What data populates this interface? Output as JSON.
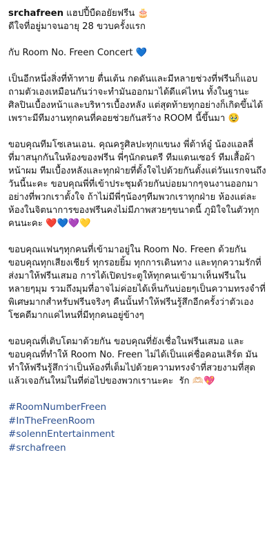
{
  "caption": {
    "username": "srchafreen",
    "header_text": " แฮปปี้บืดอยัยฟรีน 🎂",
    "lines": [
      "ดีใจที่อยู่มาจนอายุ 28 ขวบครั้งแรก",
      "",
      "กับ Room No. Freen Concert 💙",
      "",
      "เป็นอีกหนึ่งสิ่งที่ท้าทาย ตื่นเต้น กดดันและมีหลายช่วงที่ฟรีนก็แอบถามตัวเองเหมือนกันว่าจะทำมันออกมาได้ดีแค่ไหน ทั้งในฐานะศิลปินเบื้องหน้าและบริหารเบื้องหลัง แต่สุดท้ายทุกอย่างก็เกิดขึ้นได้เพราะมีทีมงานทุกคนที่คอยช่วยกันสร้าง ROOM นี้ขึ้นมา 🥹",
      "",
      "ขอบคุณทีมโซเลนเอน. คุณครูศิลปะทุกแขนง พี่ต้าห์อู๋ น้องแอลลี่ที่มาสนุกกันในห้องของฟรีน พี่ๆนักดนตรี ทีมแดนเซอร์ ทีมเสื้อผ้าหน้าผม ทีมเบื้องหลังและทุกฝ่ายที่ตั้งใจไปด้วยกันตั้งแต่วันแรกจนถึงวันนี้นะคะ ขอบคุณพี่ที่เข้าประชุมด้วยกันบ่อยมากๆจนงานออกมาอย่างที่พวกเราตั้งใจ ถ้าไม่มีพี่ๆน้องๆทีมพวกเราทุกฝ่าย ห้องแต่ละห้องในจิตนาการของฟรีนคงไม่มีภาพสวยๆขนาดนี้ ภูมิใจในตัวทุกคนนะคะ ❤️💙💜💛",
      "",
      "ขอบคุณแฟนๆทุกคนที่เข้ามาอยู่ใน Room No. Freen ด้วยกัน ขอบคุณทุกเสียงเชียร์ ทุกรอยยิ้ม ทุกการเดินทาง และทุกความรักที่ส่งมาให้ฟรีนเสมอ การได้เปิดประตูให้ทุกคนเข้ามาเห็นฟรีนในหลายๆมุม รวมถึงมุมที่อาจไม่ค่อยได้เห็นกันบ่อยๆเป็นความทรงจำที่พิเศษมากสำหรับฟรีนจริงๆ คืนนั้นทำให้ฟรีนรู้สึกอีกครั้งว่าตัวเองโชคดีมากแค่ไหนที่มีทุกคนอยู่ข้างๆ",
      "",
      "ขอบคุณที่เติบโตมาด้วยกัน ขอบคุณที่ยังเชื่อในฟรีนเสมอ และขอบคุณที่ทำให้ Room No. Freen ไม่ได้เป็นแค่ชื่อคอนเสิร์ต มันทำให้ฟรีนรู้สึกว่าเป็นห้องที่เต็มไปด้วยความทรงจำที่สวยงามที่สุด",
      "แล้วเจอกันใหม่ในที่ต่อไปของพวกเรานะคะ  รัก 🫶🏻💖"
    ],
    "hashtags": [
      "#RoomNumberFreen",
      "#InTheFreenRoom",
      "#solennEntertainment",
      "#srchafreen"
    ]
  }
}
